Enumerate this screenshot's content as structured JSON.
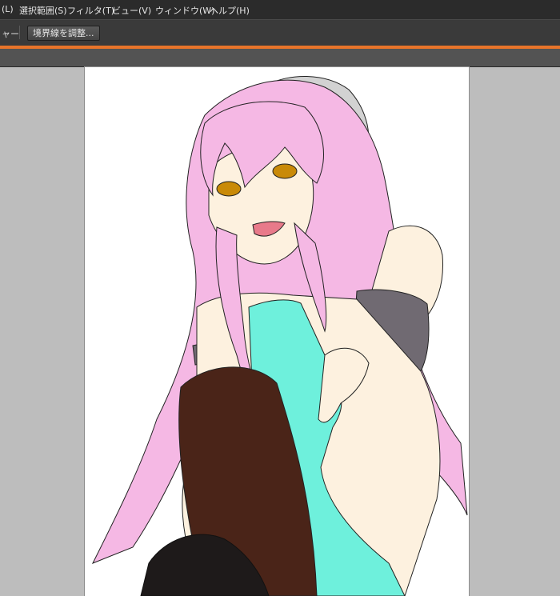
{
  "menubar": {
    "items": [
      {
        "label": "(L)"
      },
      {
        "label": "選択範囲(S)"
      },
      {
        "label": "フィルタ(T)"
      },
      {
        "label": "ビュー(V)"
      },
      {
        "label": "ウィンドウ(W)"
      },
      {
        "label": "ヘルプ(H)"
      }
    ]
  },
  "options_bar": {
    "left_label": "ャー",
    "refine_edge_button": "境界線を調整..."
  },
  "colors": {
    "menubar_bg": "#2b2b2b",
    "options_bg": "#3a3a3a",
    "accent": "#e8742a",
    "canvas_bg": "#bdbdbd",
    "hair": "#f5b8e4",
    "skin": "#fdf1df",
    "top": "#6ef0dc",
    "sleeve": "#706a72",
    "boot": "#4a2418",
    "stocking": "#1e1a1a",
    "eye": "#c98a08",
    "hat": "#d2d2d2"
  },
  "icons": []
}
